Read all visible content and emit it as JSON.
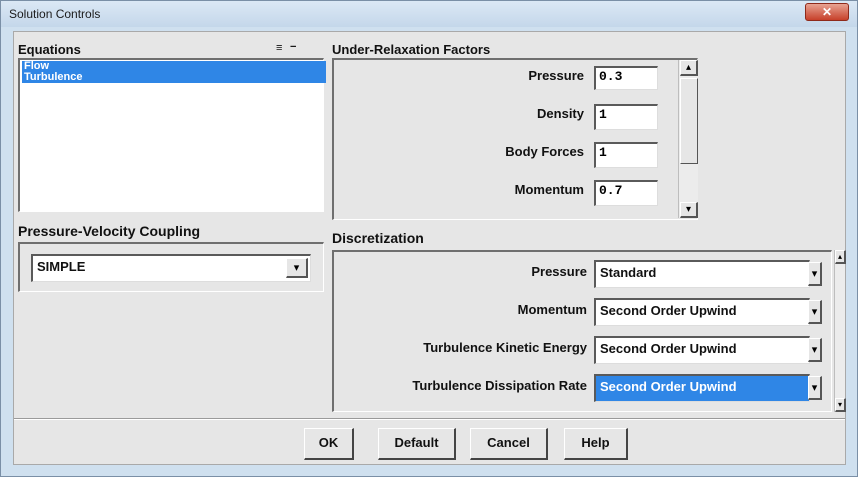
{
  "window": {
    "title": "Solution Controls",
    "close_glyph": "✕"
  },
  "equations": {
    "label": "Equations",
    "menu_glyph": "≡",
    "minus_glyph": "−",
    "items": [
      "Flow",
      "Turbulence"
    ]
  },
  "pv_coupling": {
    "label": "Pressure-Velocity Coupling",
    "value": "SIMPLE"
  },
  "urf": {
    "label": "Under-Relaxation Factors",
    "rows": [
      {
        "label": "Pressure",
        "value": "0.3"
      },
      {
        "label": "Density",
        "value": "1"
      },
      {
        "label": "Body Forces",
        "value": "1"
      },
      {
        "label": "Momentum",
        "value": "0.7"
      }
    ]
  },
  "discretization": {
    "label": "Discretization",
    "rows": [
      {
        "label": "Pressure",
        "value": "Standard"
      },
      {
        "label": "Momentum",
        "value": "Second Order Upwind"
      },
      {
        "label": "Turbulence Kinetic Energy",
        "value": "Second Order Upwind"
      },
      {
        "label": "Turbulence Dissipation Rate",
        "value": "Second Order Upwind"
      }
    ]
  },
  "buttons": {
    "ok": "OK",
    "default": "Default",
    "cancel": "Cancel",
    "help": "Help"
  },
  "glyphs": {
    "down_arrow": "▾",
    "up_arrow": "▴"
  },
  "colors": {
    "selection": "#2f86e6",
    "panel": "#e6e6e6"
  }
}
